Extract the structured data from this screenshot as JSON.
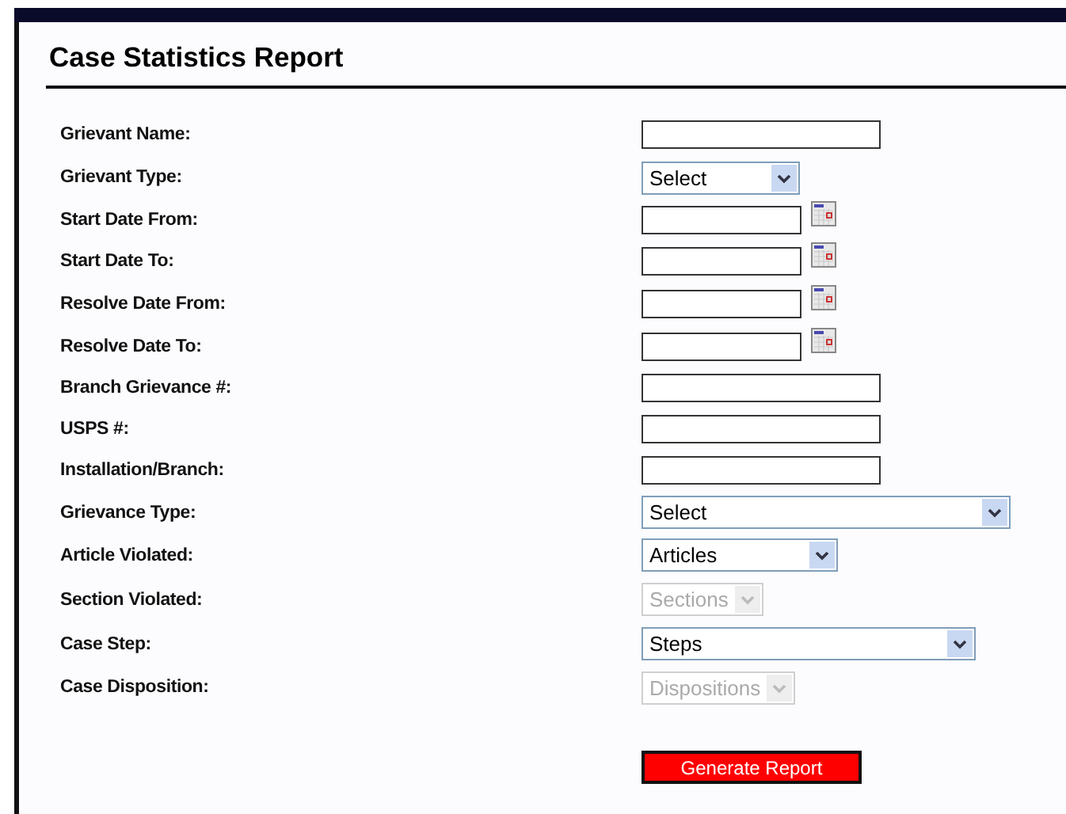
{
  "title": "Case Statistics Report",
  "fields": [
    {
      "label": "Grievant Name:",
      "kind": "text"
    },
    {
      "label": "Grievant Type:",
      "kind": "select",
      "value": "Select",
      "disabled": false
    },
    {
      "label": "Start Date From:",
      "kind": "date"
    },
    {
      "label": "Start Date To:",
      "kind": "date"
    },
    {
      "label": "Resolve Date From:",
      "kind": "date"
    },
    {
      "label": "Resolve Date To:",
      "kind": "date"
    },
    {
      "label": "Branch Grievance #:",
      "kind": "text"
    },
    {
      "label": "USPS #:",
      "kind": "text"
    },
    {
      "label": "Installation/Branch:",
      "kind": "text"
    },
    {
      "label": "Grievance Type:",
      "kind": "select",
      "value": "Select",
      "disabled": false
    },
    {
      "label": "Article Violated:",
      "kind": "select",
      "value": "Articles",
      "disabled": false
    },
    {
      "label": "Section Violated:",
      "kind": "select",
      "value": "Sections",
      "disabled": true
    },
    {
      "label": "Case Step:",
      "kind": "select",
      "value": "Steps",
      "disabled": false
    },
    {
      "label": "Case Disposition:",
      "kind": "select",
      "value": "Dispositions",
      "disabled": true
    }
  ],
  "button": "Generate Report"
}
